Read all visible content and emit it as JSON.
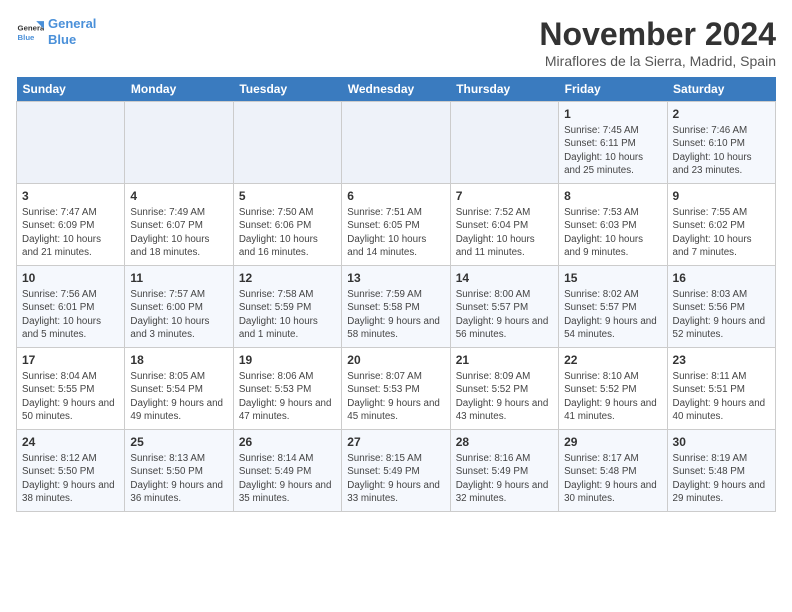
{
  "header": {
    "logo_line1": "General",
    "logo_line2": "Blue",
    "month": "November 2024",
    "location": "Miraflores de la Sierra, Madrid, Spain"
  },
  "weekdays": [
    "Sunday",
    "Monday",
    "Tuesday",
    "Wednesday",
    "Thursday",
    "Friday",
    "Saturday"
  ],
  "weeks": [
    [
      {
        "day": "",
        "info": ""
      },
      {
        "day": "",
        "info": ""
      },
      {
        "day": "",
        "info": ""
      },
      {
        "day": "",
        "info": ""
      },
      {
        "day": "",
        "info": ""
      },
      {
        "day": "1",
        "info": "Sunrise: 7:45 AM\nSunset: 6:11 PM\nDaylight: 10 hours and 25 minutes."
      },
      {
        "day": "2",
        "info": "Sunrise: 7:46 AM\nSunset: 6:10 PM\nDaylight: 10 hours and 23 minutes."
      }
    ],
    [
      {
        "day": "3",
        "info": "Sunrise: 7:47 AM\nSunset: 6:09 PM\nDaylight: 10 hours and 21 minutes."
      },
      {
        "day": "4",
        "info": "Sunrise: 7:49 AM\nSunset: 6:07 PM\nDaylight: 10 hours and 18 minutes."
      },
      {
        "day": "5",
        "info": "Sunrise: 7:50 AM\nSunset: 6:06 PM\nDaylight: 10 hours and 16 minutes."
      },
      {
        "day": "6",
        "info": "Sunrise: 7:51 AM\nSunset: 6:05 PM\nDaylight: 10 hours and 14 minutes."
      },
      {
        "day": "7",
        "info": "Sunrise: 7:52 AM\nSunset: 6:04 PM\nDaylight: 10 hours and 11 minutes."
      },
      {
        "day": "8",
        "info": "Sunrise: 7:53 AM\nSunset: 6:03 PM\nDaylight: 10 hours and 9 minutes."
      },
      {
        "day": "9",
        "info": "Sunrise: 7:55 AM\nSunset: 6:02 PM\nDaylight: 10 hours and 7 minutes."
      }
    ],
    [
      {
        "day": "10",
        "info": "Sunrise: 7:56 AM\nSunset: 6:01 PM\nDaylight: 10 hours and 5 minutes."
      },
      {
        "day": "11",
        "info": "Sunrise: 7:57 AM\nSunset: 6:00 PM\nDaylight: 10 hours and 3 minutes."
      },
      {
        "day": "12",
        "info": "Sunrise: 7:58 AM\nSunset: 5:59 PM\nDaylight: 10 hours and 1 minute."
      },
      {
        "day": "13",
        "info": "Sunrise: 7:59 AM\nSunset: 5:58 PM\nDaylight: 9 hours and 58 minutes."
      },
      {
        "day": "14",
        "info": "Sunrise: 8:00 AM\nSunset: 5:57 PM\nDaylight: 9 hours and 56 minutes."
      },
      {
        "day": "15",
        "info": "Sunrise: 8:02 AM\nSunset: 5:57 PM\nDaylight: 9 hours and 54 minutes."
      },
      {
        "day": "16",
        "info": "Sunrise: 8:03 AM\nSunset: 5:56 PM\nDaylight: 9 hours and 52 minutes."
      }
    ],
    [
      {
        "day": "17",
        "info": "Sunrise: 8:04 AM\nSunset: 5:55 PM\nDaylight: 9 hours and 50 minutes."
      },
      {
        "day": "18",
        "info": "Sunrise: 8:05 AM\nSunset: 5:54 PM\nDaylight: 9 hours and 49 minutes."
      },
      {
        "day": "19",
        "info": "Sunrise: 8:06 AM\nSunset: 5:53 PM\nDaylight: 9 hours and 47 minutes."
      },
      {
        "day": "20",
        "info": "Sunrise: 8:07 AM\nSunset: 5:53 PM\nDaylight: 9 hours and 45 minutes."
      },
      {
        "day": "21",
        "info": "Sunrise: 8:09 AM\nSunset: 5:52 PM\nDaylight: 9 hours and 43 minutes."
      },
      {
        "day": "22",
        "info": "Sunrise: 8:10 AM\nSunset: 5:52 PM\nDaylight: 9 hours and 41 minutes."
      },
      {
        "day": "23",
        "info": "Sunrise: 8:11 AM\nSunset: 5:51 PM\nDaylight: 9 hours and 40 minutes."
      }
    ],
    [
      {
        "day": "24",
        "info": "Sunrise: 8:12 AM\nSunset: 5:50 PM\nDaylight: 9 hours and 38 minutes."
      },
      {
        "day": "25",
        "info": "Sunrise: 8:13 AM\nSunset: 5:50 PM\nDaylight: 9 hours and 36 minutes."
      },
      {
        "day": "26",
        "info": "Sunrise: 8:14 AM\nSunset: 5:49 PM\nDaylight: 9 hours and 35 minutes."
      },
      {
        "day": "27",
        "info": "Sunrise: 8:15 AM\nSunset: 5:49 PM\nDaylight: 9 hours and 33 minutes."
      },
      {
        "day": "28",
        "info": "Sunrise: 8:16 AM\nSunset: 5:49 PM\nDaylight: 9 hours and 32 minutes."
      },
      {
        "day": "29",
        "info": "Sunrise: 8:17 AM\nSunset: 5:48 PM\nDaylight: 9 hours and 30 minutes."
      },
      {
        "day": "30",
        "info": "Sunrise: 8:19 AM\nSunset: 5:48 PM\nDaylight: 9 hours and 29 minutes."
      }
    ]
  ]
}
